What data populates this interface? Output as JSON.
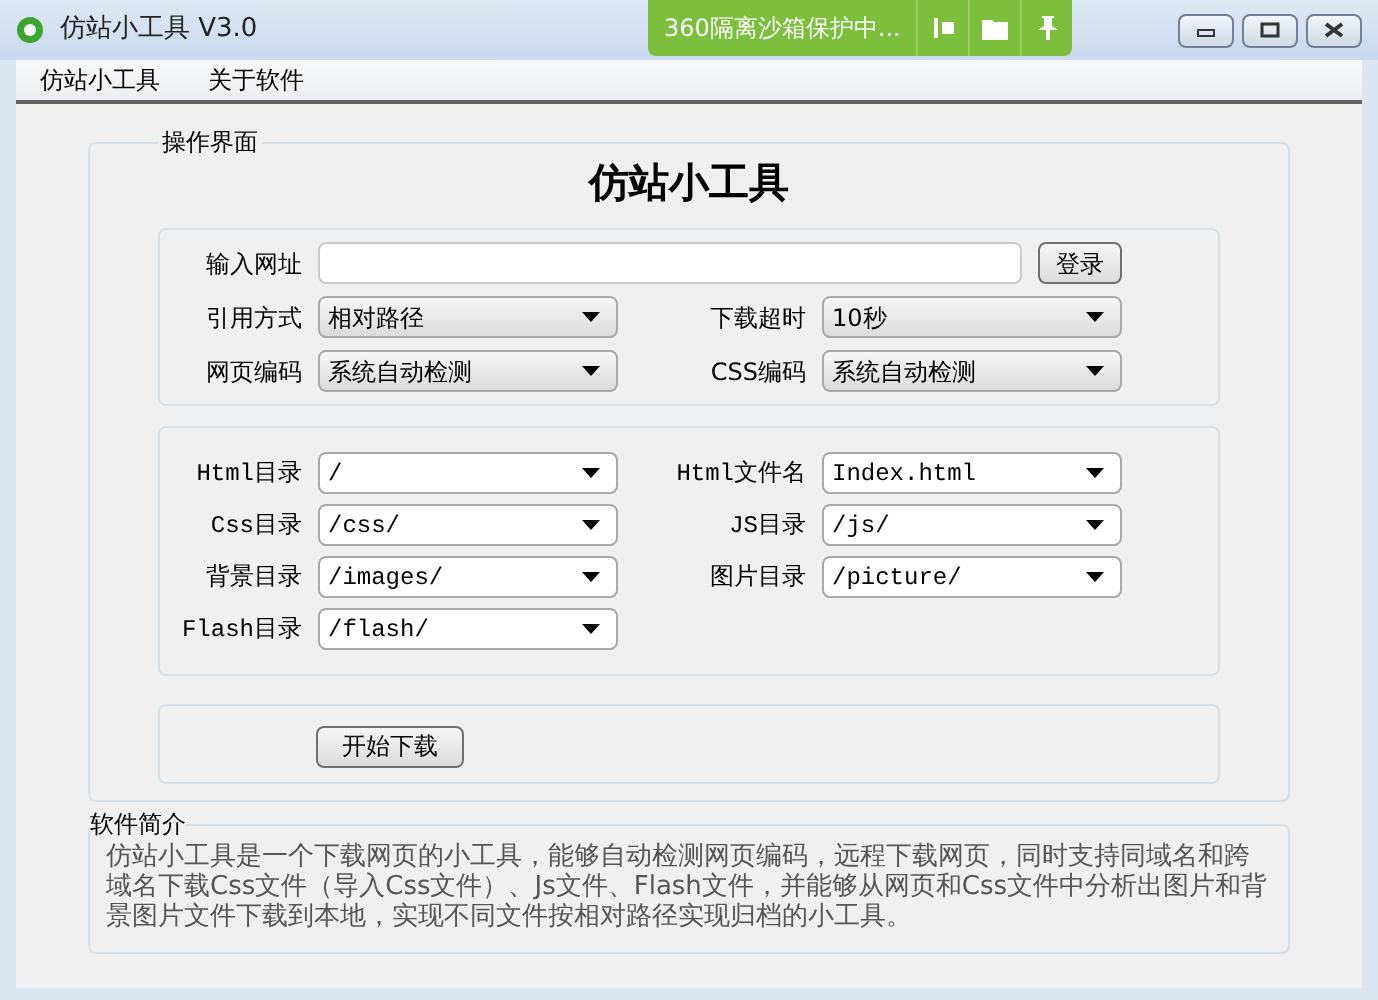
{
  "window": {
    "title": "仿站小工具 V3.0"
  },
  "sandbox": {
    "label": "360隔离沙箱保护中..."
  },
  "menu": [
    "仿站小工具",
    "关于软件"
  ],
  "main_group": {
    "legend": "操作界面",
    "heading": "仿站小工具"
  },
  "url_row": {
    "label": "输入网址",
    "button": "登录"
  },
  "settings": [
    [
      {
        "label": "引用方式",
        "value": "相对路径"
      },
      {
        "label": "下载超时",
        "value": "10秒"
      }
    ],
    [
      {
        "label": "网页编码",
        "value": "系统自动检测"
      },
      {
        "label": "CSS编码",
        "value": "系统自动检测"
      }
    ]
  ],
  "dirs": [
    [
      {
        "label": "Html目录",
        "value": "/"
      },
      {
        "label": "Html文件名",
        "value": "Index.html"
      }
    ],
    [
      {
        "label": "Css目录",
        "value": "/css/"
      },
      {
        "label": "JS目录",
        "value": "/js/"
      }
    ],
    [
      {
        "label": "背景目录",
        "value": "/images/"
      },
      {
        "label": "图片目录",
        "value": "/picture/"
      }
    ],
    [
      {
        "label": "Flash目录",
        "value": "/flash/"
      }
    ]
  ],
  "start_button": "开始下载",
  "about": {
    "legend": "软件简介",
    "text": "仿站小工具是一个下载网页的小工具，能够自动检测网页编码，远程下载网页，同时支持同域名和跨域名下载Css文件（导入Css文件）、Js文件、Flash文件，并能够从网页和Css文件中分析出图片和背景图片文件下载到本地，实现不同文件按相对路径实现归档的小工具。"
  }
}
